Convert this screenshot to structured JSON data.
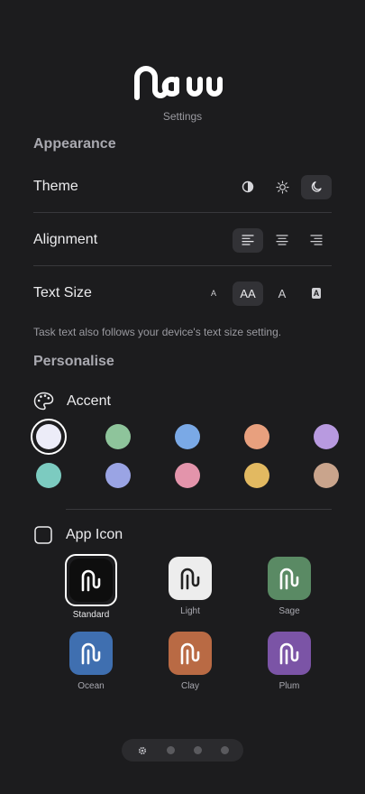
{
  "header": {
    "logo_text": "Nauu",
    "subtitle": "Settings"
  },
  "appearance": {
    "heading": "Appearance",
    "theme": {
      "label": "Theme",
      "options": [
        "auto",
        "light",
        "dark"
      ],
      "selected": "dark"
    },
    "alignment": {
      "label": "Alignment",
      "options": [
        "left",
        "center",
        "right"
      ],
      "selected": "left"
    },
    "text_size": {
      "label": "Text Size",
      "options": [
        "A",
        "AA",
        "A",
        "A"
      ],
      "selected_index": 1
    },
    "note": "Task text also follows your device's text size setting."
  },
  "personalise": {
    "heading": "Personalise",
    "accent": {
      "label": "Accent",
      "colors": [
        "#ececf8",
        "#8ec49b",
        "#7aa9e6",
        "#e8a07e",
        "#b89ae0",
        "#7ccbc0",
        "#9aa4e4",
        "#e394ab",
        "#e2b961",
        "#c9a48c"
      ],
      "selected_index": 0
    },
    "app_icon": {
      "label": "App Icon",
      "icons": [
        {
          "name": "Standard",
          "bg": "#0e0e0e",
          "fg": "#ffffff"
        },
        {
          "name": "Light",
          "bg": "#ededed",
          "fg": "#222222"
        },
        {
          "name": "Sage",
          "bg": "#5a8a64",
          "fg": "#ffffff"
        },
        {
          "name": "Ocean",
          "bg": "#3f6fb0",
          "fg": "#ffffff"
        },
        {
          "name": "Clay",
          "bg": "#b96a44",
          "fg": "#ffffff"
        },
        {
          "name": "Plum",
          "bg": "#7b54a6",
          "fg": "#ffffff"
        }
      ],
      "selected_index": 0
    }
  },
  "page_dots": {
    "count": 3,
    "first_icon": "gear-icon"
  }
}
